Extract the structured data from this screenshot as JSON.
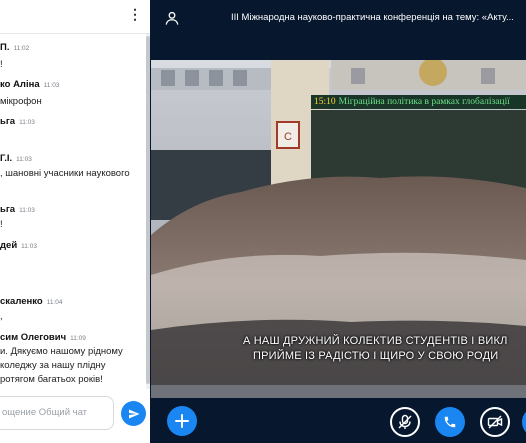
{
  "chat": {
    "menu_icon": "kebab-menu-icon",
    "messages": [
      {
        "name": "П.",
        "time": "11:02",
        "lines": [
          "!"
        ]
      },
      {
        "name": "ко Аліна",
        "time": "11:03",
        "lines": [
          "мікрофон"
        ]
      },
      {
        "name": "ьга",
        "time": "11:03",
        "lines": [
          "",
          ""
        ]
      },
      {
        "name": "Г.І.",
        "time": "11:03",
        "lines": [
          ", шановні учасники наукового",
          ""
        ]
      },
      {
        "name": "ьга",
        "time": "11:03",
        "lines": [
          "!"
        ]
      },
      {
        "name": "дей",
        "time": "11:03",
        "lines": [
          "",
          ""
        ]
      },
      {
        "name": "скаленко",
        "time": "11:04",
        "lines": [
          ","
        ]
      },
      {
        "name": "сим Олегович",
        "time": "11:09",
        "lines": [
          "и. Дякуємо нашому рідному",
          "коледжу за нашу плідну",
          "ротягом багатьох років!"
        ]
      }
    ],
    "input_placeholder": "ощение Общий чат",
    "send_icon": "send-arrow-icon",
    "accent": "#1a86f2"
  },
  "topbar": {
    "user_icon": "user-icon",
    "title": "III Міжнародна науково-практична конференція на тему: «Акту..."
  },
  "video": {
    "ticker_time": "15:10",
    "ticker_text": "Міграційна політика в рамках глобалізації",
    "building_sign": "С",
    "caption_line1": "А НАШ ДРУЖНИЙ КОЛЕКТИВ СТУДЕНТІВ І ВИКЛ",
    "caption_line2": "ПРИЙМЕ ІЗ РАДІСТЮ І ЩИРО У СВОЮ РОДИ"
  },
  "controls": {
    "add_icon": "plus-icon",
    "mic_icon": "mic-muted-icon",
    "phone_icon": "phone-icon",
    "camera_icon": "camera-off-icon",
    "more_icon": "more-icon"
  }
}
